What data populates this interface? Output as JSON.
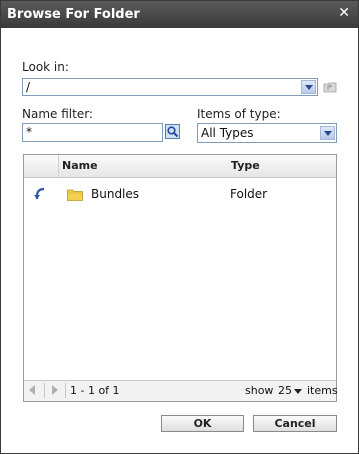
{
  "window": {
    "title": "Browse For Folder"
  },
  "look_in": {
    "label": "Look in:",
    "value": "/"
  },
  "name_filter": {
    "label": "Name filter:",
    "value": "*"
  },
  "items_of_type": {
    "label": "Items of type:",
    "value": "All Types"
  },
  "grid": {
    "columns": [
      "Name",
      "Type"
    ],
    "rows": [
      {
        "name": "Bundles",
        "type": "Folder"
      }
    ],
    "footer": {
      "range": "1 - 1 of 1",
      "show_label": "show",
      "page_size": "25",
      "items_label": "items"
    }
  },
  "buttons": {
    "ok": "OK",
    "cancel": "Cancel"
  }
}
